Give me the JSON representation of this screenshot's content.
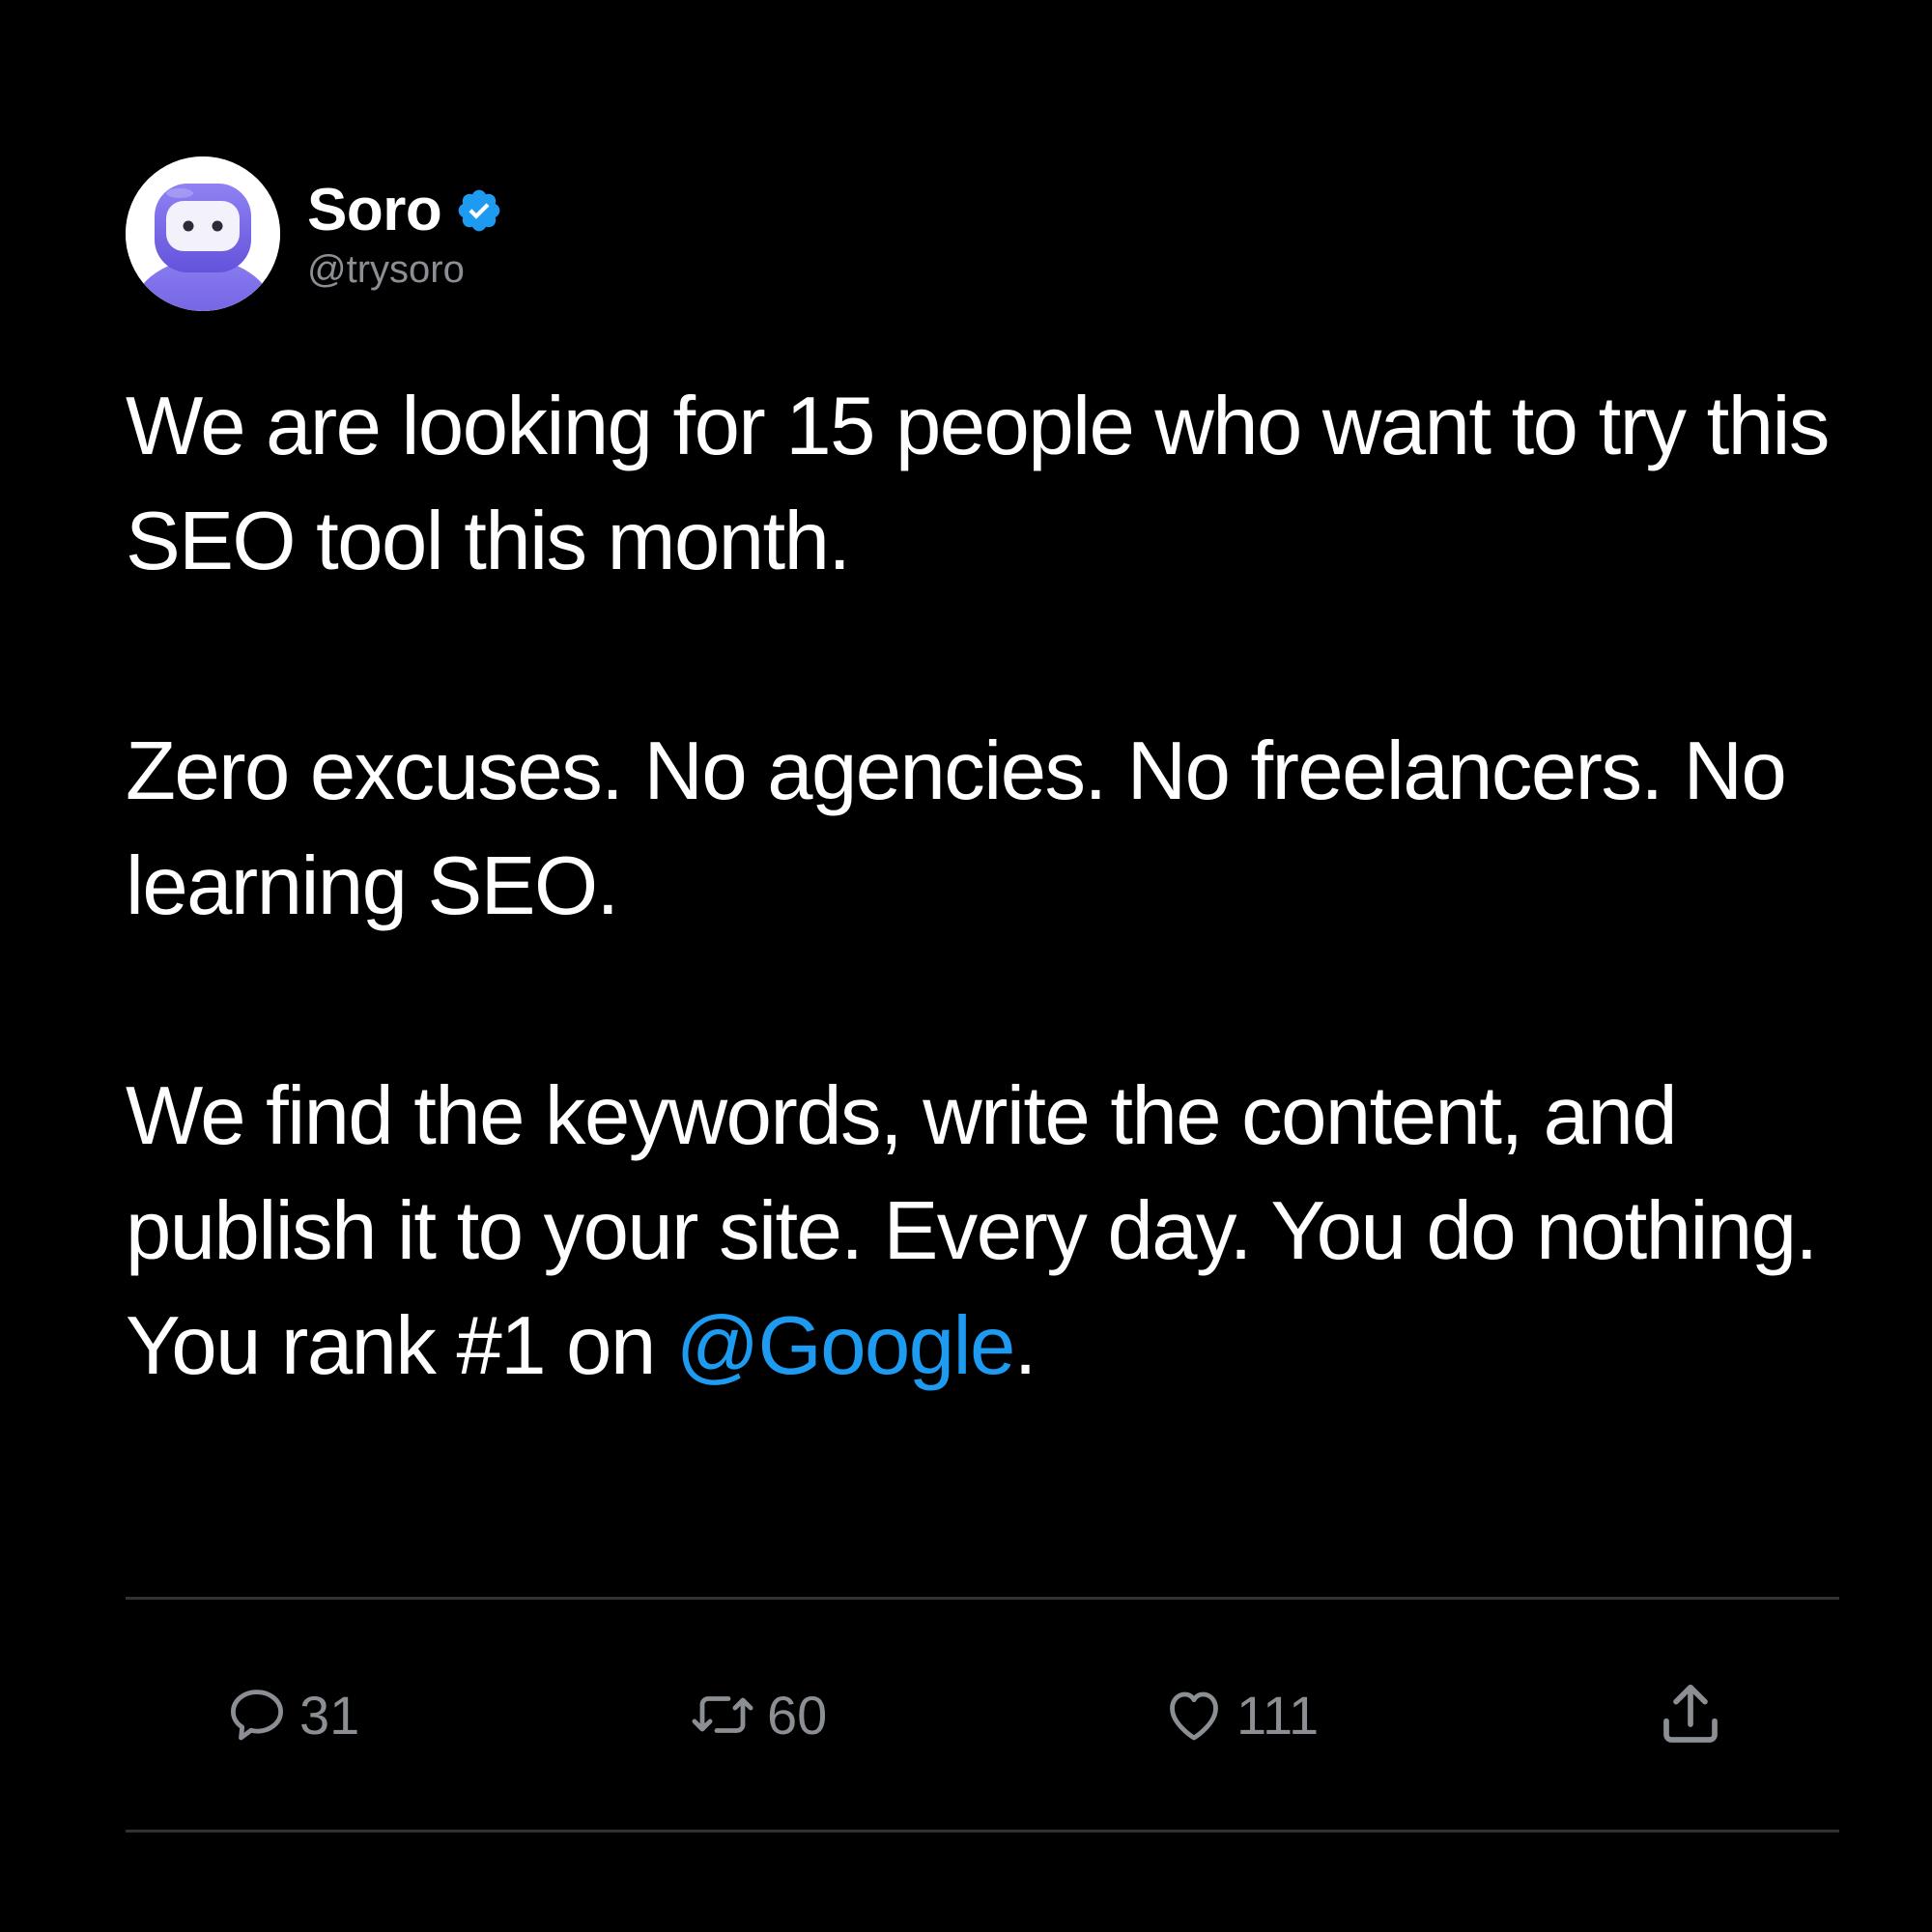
{
  "tweet": {
    "author": {
      "display_name": "Soro",
      "handle": "@trysoro",
      "verified": true,
      "avatar_icon": "robot-avatar-icon"
    },
    "paragraphs": [
      {
        "text": "We are looking for 15 people who want to try this SEO tool this month."
      },
      {
        "text": "Zero excuses. No agencies. No freelancers. No learning SEO."
      },
      {
        "text_before_mention": "We find the keywords, write the content, and publish it to your site. Every day. You do nothing. You rank #1 on ",
        "mention": "@Google",
        "text_after_mention": "."
      }
    ],
    "actions": {
      "reply": {
        "icon": "reply-icon",
        "count": "31"
      },
      "retweet": {
        "icon": "retweet-icon",
        "count": "60"
      },
      "like": {
        "icon": "heart-icon",
        "count": "111"
      },
      "share": {
        "icon": "share-icon"
      }
    }
  },
  "colors": {
    "background": "#000000",
    "text": "#ffffff",
    "secondary_text": "#8b8f94",
    "mention": "#1d9bf0",
    "verified_badge": "#1d9bf0",
    "divider": "#2f3336",
    "avatar_purple": "#6c5ce7"
  }
}
